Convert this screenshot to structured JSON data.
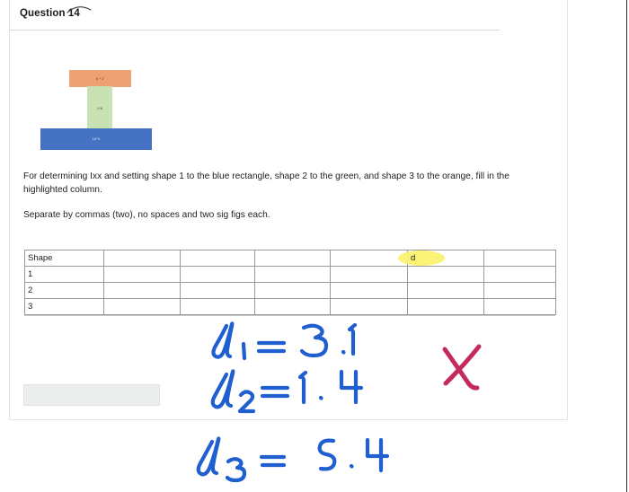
{
  "card": {
    "title": "Question 14"
  },
  "figure": {
    "caption_shapes": [
      {
        "name": "orange-flange",
        "label": "6 * 2",
        "color": "#eea273"
      },
      {
        "name": "green-web",
        "label": "1*6",
        "color": "#c9e2b4"
      },
      {
        "name": "blue-base",
        "label": "12*3",
        "color": "#4573c4"
      }
    ]
  },
  "prose": {
    "paragraph_1": "For determining Ixx and setting shape 1 to the blue rectangle, shape 2 to the green, and shape 3 to the orange, fill in the highlighted column.",
    "paragraph_2": "Separate by commas (two), no spaces and two sig figs each."
  },
  "table": {
    "header": [
      "Shape",
      "",
      "",
      "",
      "",
      "d",
      ""
    ],
    "highlighted_header": "d",
    "highlight_color": "#fbf26b",
    "rows": [
      [
        "1",
        "",
        "",
        "",
        "",
        "",
        ""
      ],
      [
        "2",
        "",
        "",
        "",
        "",
        "",
        ""
      ],
      [
        "3",
        "",
        "",
        "",
        "",
        "",
        ""
      ]
    ]
  },
  "answer": {
    "value": "",
    "placeholder": ""
  },
  "annotations": {
    "ink_color": "#1f5fd0",
    "mark_color": "#c42a5c",
    "lines": [
      {
        "name": "d1",
        "text": "d₁ = 3.1"
      },
      {
        "name": "d2",
        "text": "d₂ = 1.4"
      },
      {
        "name": "d3",
        "text": "d₃ = 5.4"
      }
    ],
    "grade_mark": "X"
  }
}
